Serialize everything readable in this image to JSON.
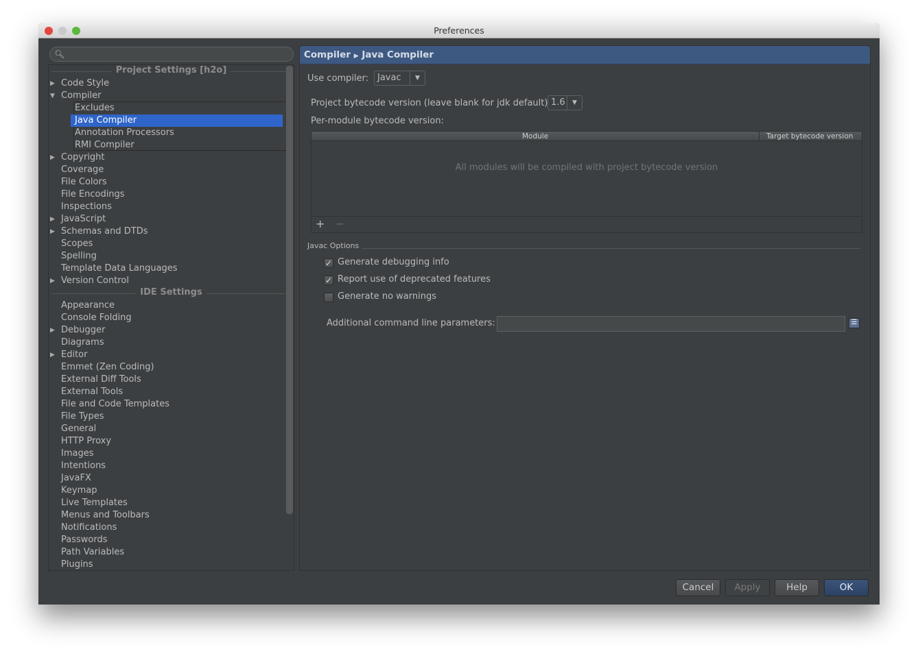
{
  "window": {
    "title": "Preferences"
  },
  "search": {
    "placeholder": ""
  },
  "tree": [
    {
      "type": "section",
      "label": "Project Settings [h2o]"
    },
    {
      "label": "Code Style",
      "arrow": "right"
    },
    {
      "label": "Compiler",
      "arrow": "down"
    },
    {
      "label": "Excludes",
      "level": 1
    },
    {
      "label": "Java Compiler",
      "level": 1,
      "selected": true
    },
    {
      "label": "Annotation Processors",
      "level": 1
    },
    {
      "label": "RMI Compiler",
      "level": 1
    },
    {
      "label": "Copyright",
      "arrow": "right"
    },
    {
      "label": "Coverage"
    },
    {
      "label": "File Colors"
    },
    {
      "label": "File Encodings"
    },
    {
      "label": "Inspections"
    },
    {
      "label": "JavaScript",
      "arrow": "right"
    },
    {
      "label": "Schemas and DTDs",
      "arrow": "right"
    },
    {
      "label": "Scopes"
    },
    {
      "label": "Spelling"
    },
    {
      "label": "Template Data Languages"
    },
    {
      "label": "Version Control",
      "arrow": "right"
    },
    {
      "type": "section",
      "label": "IDE Settings"
    },
    {
      "label": "Appearance"
    },
    {
      "label": "Console Folding"
    },
    {
      "label": "Debugger",
      "arrow": "right"
    },
    {
      "label": "Diagrams"
    },
    {
      "label": "Editor",
      "arrow": "right"
    },
    {
      "label": "Emmet (Zen Coding)"
    },
    {
      "label": "External Diff Tools"
    },
    {
      "label": "External Tools"
    },
    {
      "label": "File and Code Templates"
    },
    {
      "label": "File Types"
    },
    {
      "label": "General"
    },
    {
      "label": "HTTP Proxy"
    },
    {
      "label": "Images"
    },
    {
      "label": "Intentions"
    },
    {
      "label": "JavaFX"
    },
    {
      "label": "Keymap"
    },
    {
      "label": "Live Templates"
    },
    {
      "label": "Menus and Toolbars"
    },
    {
      "label": "Notifications"
    },
    {
      "label": "Passwords"
    },
    {
      "label": "Path Variables"
    },
    {
      "label": "Plugins"
    }
  ],
  "main": {
    "breadcrumb": [
      "Compiler",
      "Java Compiler"
    ],
    "use_compiler_label": "Use compiler:",
    "use_compiler_value": "Javac",
    "bytecode_label": "Project bytecode version (leave blank for jdk default):",
    "bytecode_value": "1.6",
    "per_module_label": "Per-module bytecode version:",
    "table": {
      "columns": [
        "Module",
        "Target bytecode version"
      ],
      "empty_text": "All modules will be compiled with project bytecode version",
      "add": "+",
      "remove": "−"
    },
    "javac_options_title": "Javac Options",
    "options": [
      {
        "label": "Generate debugging info",
        "checked": true
      },
      {
        "label": "Report use of deprecated features",
        "checked": true
      },
      {
        "label": "Generate no warnings",
        "checked": false
      }
    ],
    "cmdline_label": "Additional command line parameters:",
    "cmdline_value": ""
  },
  "buttons": {
    "cancel": "Cancel",
    "apply": "Apply",
    "help": "Help",
    "ok": "OK"
  },
  "colors": {
    "selection": "#2f65ca",
    "header": "#3e5981",
    "background": "#3c3f41"
  }
}
